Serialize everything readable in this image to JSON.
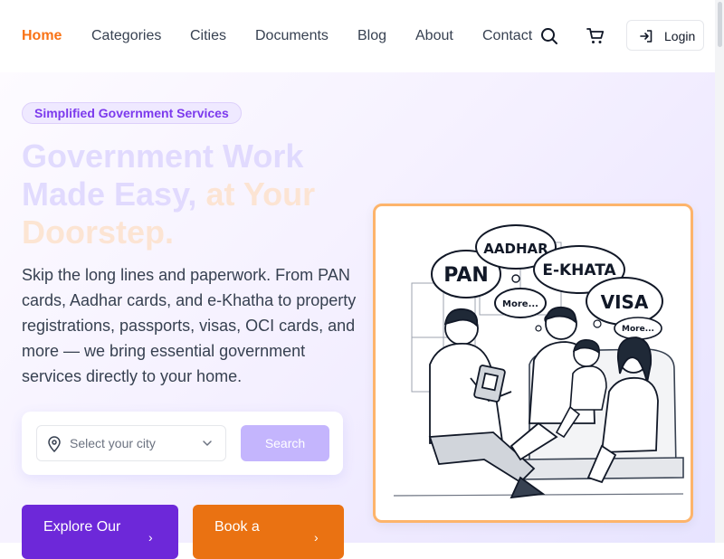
{
  "nav": {
    "items": [
      "Home",
      "Categories",
      "Cities",
      "Documents",
      "Blog",
      "About",
      "Contact"
    ],
    "active": "Home",
    "search_icon": "search-icon",
    "cart_icon": "cart-icon",
    "login_icon": "login-icon",
    "login_label": "Login"
  },
  "hero": {
    "badge": "Simplified Government Services",
    "headline_part1": "Government Work Made Easy,",
    "headline_part2": "at Your Doorstep.",
    "description": "Skip the long lines and paperwork. From PAN cards, Aadhar cards, and e-Khatha to property registrations, passports, visas, OCI cards, and more — we bring essential government services directly to your home.",
    "city_placeholder": "Select your city",
    "search_label": "Search",
    "cta_primary": "Explore Our",
    "cta_secondary": "Book a"
  },
  "illustration": {
    "bubbles": [
      "AADHAR",
      "PAN",
      "E-KHATA",
      "VISA",
      "More...",
      "More..."
    ]
  },
  "colors": {
    "accent_orange": "#f97316",
    "primary_purple": "#6d28d9",
    "cta_orange": "#ea7212",
    "search_button": "#c4b5fd",
    "frame_border": "#fdb46b"
  }
}
